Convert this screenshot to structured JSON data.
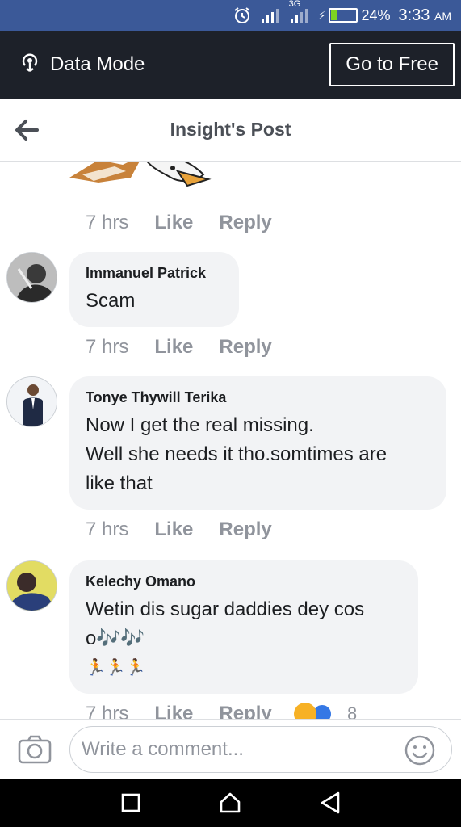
{
  "status_bar": {
    "network_type": "3G",
    "battery": "24%",
    "battery_level": 0.24,
    "time": "3:33",
    "ampm": "AM"
  },
  "banner": {
    "mode_label": "Data Mode",
    "cta_label": "Go to Free"
  },
  "header": {
    "title": "Insight's Post"
  },
  "first_meta": {
    "time": "7 hrs",
    "like": "Like",
    "reply": "Reply"
  },
  "comments": [
    {
      "author": "Immanuel Patrick",
      "lines": [
        "Scam"
      ],
      "time": "7 hrs",
      "like": "Like",
      "reply": "Reply"
    },
    {
      "author": "Tonye Thywill Terika",
      "lines": [
        "Now I get the real missing.",
        "Well she needs it tho.somtimes are",
        "like that"
      ],
      "time": "7 hrs",
      "like": "Like",
      "reply": "Reply"
    },
    {
      "author": "Kelechy Omano",
      "lines": [
        "Wetin dis sugar daddies dey cos",
        "o🎶🎶",
        "🏃🏃🏃"
      ],
      "time": "7 hrs",
      "like": "Like",
      "reply": "Reply",
      "reaction_count": "8"
    }
  ],
  "composer": {
    "placeholder": "Write a comment..."
  },
  "colors": {
    "status_bar": "#3b5998",
    "banner": "#1d2129",
    "bubble": "#f2f3f5",
    "meta": "#90949c"
  }
}
